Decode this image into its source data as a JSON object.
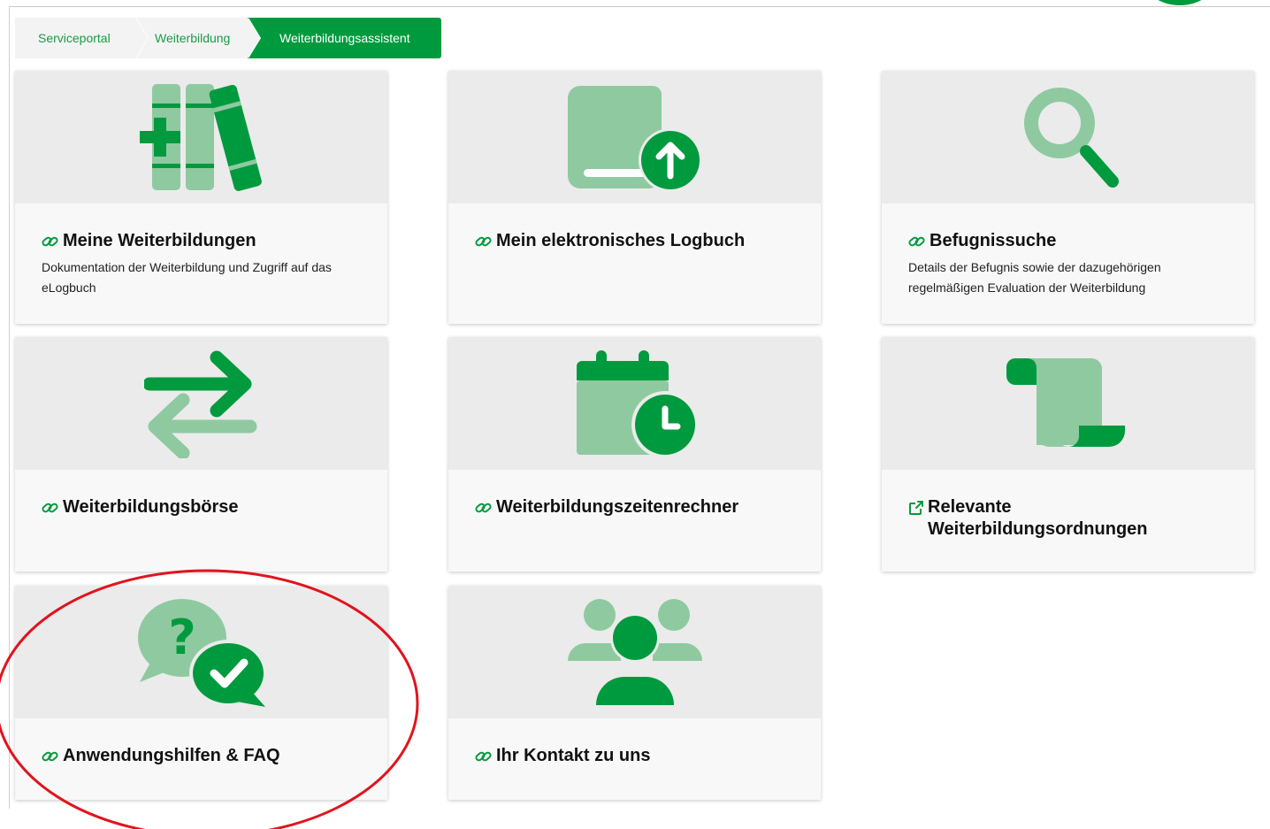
{
  "colors": {
    "brand_green": "#009a3e",
    "light_green": "#8fc9a0",
    "tile_icon_bg": "#ebebeb",
    "tile_body_bg": "#f8f8f8",
    "breadcrumb_bg": "#f3f3f3",
    "annotation_red": "#e0141e"
  },
  "breadcrumb": {
    "items": [
      "Serviceportal",
      "Weiterbildung",
      "Weiterbildungsassistent"
    ]
  },
  "tiles": [
    {
      "title": "Meine Weiterbildungen",
      "description": "Dokumentation der Weiterbildung und Zugriff auf das eLogbuch",
      "icon": "books-icon",
      "link_type": "link-icon"
    },
    {
      "title": "Mein elektronisches Logbuch",
      "description": "",
      "icon": "logbook-upload-icon",
      "link_type": "link-icon"
    },
    {
      "title": "Befugnissuche",
      "description": "Details der Befugnis sowie der dazugehörigen regelmäßigen Evaluation der Weiterbildung",
      "icon": "search-icon",
      "link_type": "link-icon"
    },
    {
      "title": "Weiterbildungsbörse",
      "description": "",
      "icon": "exchange-arrows-icon",
      "link_type": "link-icon"
    },
    {
      "title": "Weiterbildungszeitenrechner",
      "description": "",
      "icon": "calendar-clock-icon",
      "link_type": "link-icon"
    },
    {
      "title": "Relevante Weiterbildungsordnungen",
      "description": "",
      "icon": "scroll-icon",
      "link_type": "external-link-icon"
    },
    {
      "title": "Anwendungshilfen & FAQ",
      "description": "",
      "icon": "faq-chat-icon",
      "link_type": "link-icon"
    },
    {
      "title": "Ihr Kontakt zu uns",
      "description": "",
      "icon": "users-icon",
      "link_type": "link-icon"
    }
  ]
}
